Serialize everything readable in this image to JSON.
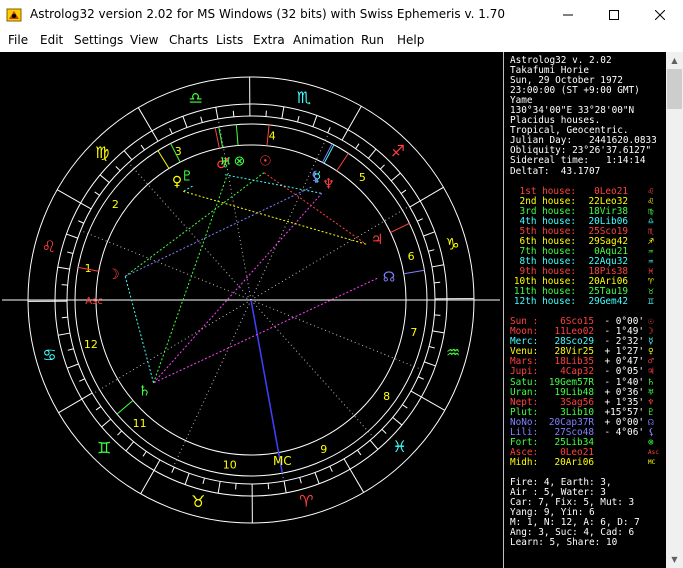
{
  "window": {
    "title": "Astrolog32 version 2.02 for MS Windows (32 bits) with Swiss Ephemeris v. 1.70",
    "icon": "astrolog-app-icon"
  },
  "menu": [
    "File",
    "Edit",
    "Settings",
    "View",
    "Charts",
    "Lists",
    "Extra",
    "Animation",
    "Run",
    "Help"
  ],
  "info": {
    "lines": [
      "Astrolog32 v. 2.02",
      "Takafumi Horie",
      "Sun, 29 October 1972",
      "23:00:00 (ST +9:00 GMT)",
      "Yame",
      "130°34'00\"E 33°28'00\"N",
      "Placidus houses.",
      "Tropical, Geocentric.",
      "Julian Day:   2441620.0833",
      "Obliquity: 23°26'37.6127\"",
      "Sidereal time:   1:14:14",
      "DeltaT:  43.1707"
    ]
  },
  "houses": [
    {
      "label": "1st house:",
      "pos": "0Leo21",
      "color": "#ff4040",
      "glyph": "♌"
    },
    {
      "label": "2nd house:",
      "pos": "22Leo32",
      "color": "#ffff00",
      "glyph": "♌"
    },
    {
      "label": "3rd house:",
      "pos": "18Vir38",
      "color": "#40ff40",
      "glyph": "♍"
    },
    {
      "label": "4th house:",
      "pos": "20Lib06",
      "color": "#40ffff",
      "glyph": "♎"
    },
    {
      "label": "5th house:",
      "pos": "25Sco19",
      "color": "#ff4040",
      "glyph": "♏"
    },
    {
      "label": "6th house:",
      "pos": "29Sag42",
      "color": "#ffff00",
      "glyph": "♐"
    },
    {
      "label": "7th house:",
      "pos": "0Aqu21",
      "color": "#40ff40",
      "glyph": "♒"
    },
    {
      "label": "8th house:",
      "pos": "22Aqu32",
      "color": "#40ffff",
      "glyph": "♒"
    },
    {
      "label": "9th house:",
      "pos": "18Pis38",
      "color": "#ff4040",
      "glyph": "♓"
    },
    {
      "label": "10th house:",
      "pos": "20Ari06",
      "color": "#ffff00",
      "glyph": "♈"
    },
    {
      "label": "11th house:",
      "pos": "25Tau19",
      "color": "#40ff40",
      "glyph": "♉"
    },
    {
      "label": "12th house:",
      "pos": "29Gem42",
      "color": "#40ffff",
      "glyph": "♊"
    }
  ],
  "planets": [
    {
      "name": "Sun :",
      "pos": "6Sco15",
      "lat": "- 0°00'",
      "color": "#ff4040",
      "glyph": "☉"
    },
    {
      "name": "Moon:",
      "pos": "11Leo02",
      "lat": "- 1°49'",
      "color": "#ff4040",
      "glyph": "☽"
    },
    {
      "name": "Merc:",
      "pos": "28Sco29",
      "lat": "- 2°32'",
      "color": "#40ffff",
      "glyph": "☿"
    },
    {
      "name": "Venu:",
      "pos": "28Vir25",
      "lat": "+ 1°27'",
      "color": "#ffff00",
      "glyph": "♀"
    },
    {
      "name": "Mars:",
      "pos": "18Lib35",
      "lat": "+ 0°47'",
      "color": "#ff4040",
      "glyph": "♂"
    },
    {
      "name": "Jupi:",
      "pos": "4Cap32",
      "lat": "- 0°05'",
      "color": "#ff4040",
      "glyph": "♃"
    },
    {
      "name": "Satu:",
      "pos": "19Gem57R",
      "lat": "- 1°40'",
      "color": "#40ff40",
      "glyph": "♄"
    },
    {
      "name": "Uran:",
      "pos": "19Lib48",
      "lat": "+ 0°36'",
      "color": "#40ff40",
      "glyph": "♅"
    },
    {
      "name": "Nept:",
      "pos": "3Sag56",
      "lat": "+ 1°35'",
      "color": "#ff4040",
      "glyph": "♆"
    },
    {
      "name": "Plut:",
      "pos": "3Lib10",
      "lat": "+15°57'",
      "color": "#40ff40",
      "glyph": "♇"
    },
    {
      "name": "NoNo:",
      "pos": "20Cap37R",
      "lat": "+ 0°00'",
      "color": "#8080ff",
      "glyph": "☊"
    },
    {
      "name": "Lili:",
      "pos": "27Sco48",
      "lat": "- 4°06'",
      "color": "#8080ff",
      "glyph": "⚸"
    },
    {
      "name": "Fort:",
      "pos": "25Lib34",
      "lat": "",
      "color": "#40ff40",
      "glyph": "⊗"
    },
    {
      "name": "Asce:",
      "pos": "0Leo21",
      "lat": "",
      "color": "#ff4040",
      "glyph": "Asc"
    },
    {
      "name": "Midh:",
      "pos": "20Ari06",
      "lat": "",
      "color": "#ffff00",
      "glyph": "MC"
    }
  ],
  "stats": [
    "Fire: 4, Earth: 3,",
    "Air : 5, Water: 3",
    "Car: 7, Fix: 5, Mut: 3",
    "Yang: 9, Yin: 6",
    "M: 1, N: 12, A: 6, D: 7",
    "Ang: 3, Suc: 4, Cad: 6",
    "Learn: 5, Share: 10"
  ],
  "wheel": {
    "zodiac_glyphs": [
      "♈",
      "♉",
      "♊",
      "♋",
      "♌",
      "♍",
      "♎",
      "♏",
      "♐",
      "♑",
      "♒",
      "♓"
    ],
    "zodiac_colors": [
      "#ff4040",
      "#ffff00",
      "#40ff40",
      "#40ffff",
      "#ff4040",
      "#ffff00",
      "#40ff40",
      "#40ffff",
      "#ff4040",
      "#ffff00",
      "#40ff40",
      "#40ffff"
    ],
    "house_numbers": [
      "1",
      "2",
      "3",
      "4",
      "5",
      "6",
      "7",
      "8",
      "9",
      "10",
      "11",
      "12"
    ],
    "asc_label": "Asc",
    "mc_label": "MC"
  }
}
